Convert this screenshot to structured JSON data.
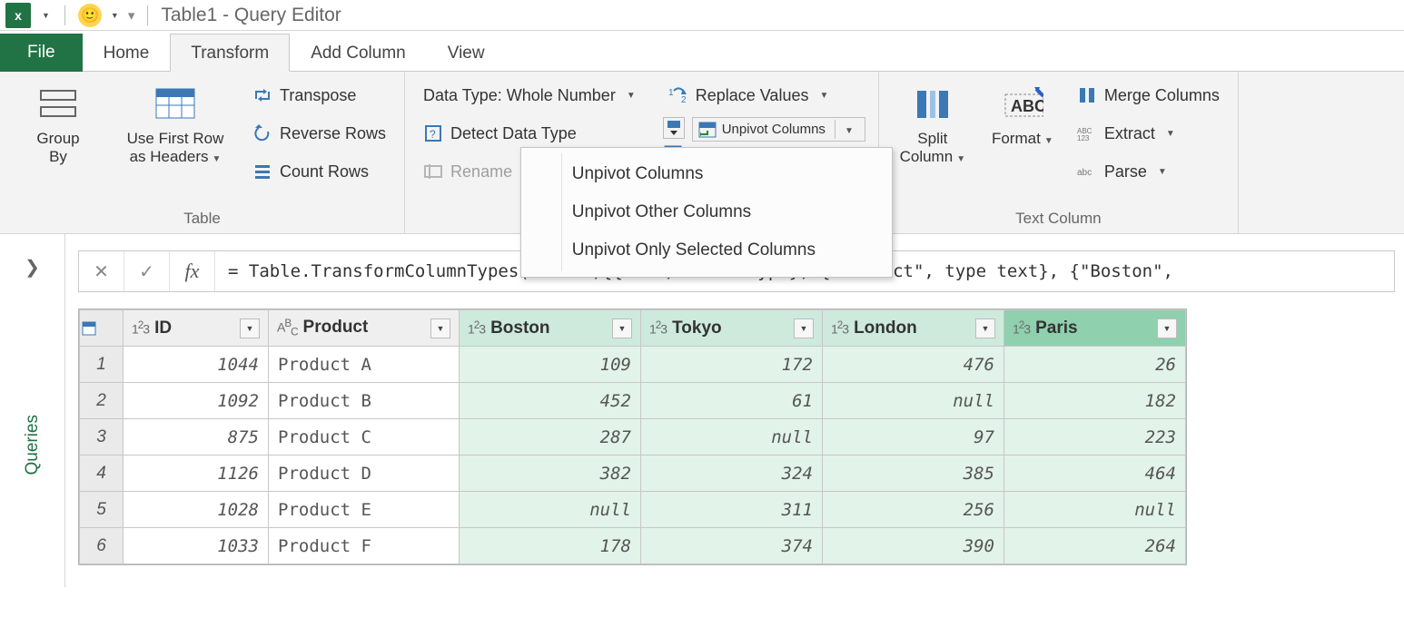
{
  "title": "Table1 - Query Editor",
  "tabs": {
    "file": "File",
    "home": "Home",
    "transform": "Transform",
    "addcol": "Add Column",
    "view": "View"
  },
  "ribbon": {
    "group_table_caption": "Table",
    "group_text_caption": "Text Column",
    "groupby": "Group\nBy",
    "firstrow": "Use First Row\nas Headers",
    "transpose": "Transpose",
    "reverse": "Reverse Rows",
    "count": "Count Rows",
    "datatype": "Data Type: Whole Number",
    "detect": "Detect Data Type",
    "rename": "Rename",
    "replace": "Replace Values",
    "unpivot": "Unpivot Columns",
    "menu": {
      "a": "Unpivot Columns",
      "b": "Unpivot Other Columns",
      "c": "Unpivot Only Selected Columns"
    },
    "split": "Split\nColumn",
    "format": "Format",
    "merge": "Merge Columns",
    "extract": "Extract",
    "parse": "Parse"
  },
  "queries_label": "Queries",
  "formula": "= Table.TransformColumnTypes(Source,{{\"ID\", Int64.Type}, {\"Product\", type text}, {\"Boston\",",
  "columns": [
    {
      "name": "ID",
      "type": "123",
      "sel": false
    },
    {
      "name": "Product",
      "type": "ABC",
      "sel": false
    },
    {
      "name": "Boston",
      "type": "123",
      "sel": true
    },
    {
      "name": "Tokyo",
      "type": "123",
      "sel": true
    },
    {
      "name": "London",
      "type": "123",
      "sel": true
    },
    {
      "name": "Paris",
      "type": "123",
      "sel": true,
      "hi": true
    }
  ],
  "rows": [
    {
      "n": "1",
      "id": "1044",
      "prod": "Product A",
      "c": [
        "109",
        "172",
        "476",
        "26"
      ]
    },
    {
      "n": "2",
      "id": "1092",
      "prod": "Product B",
      "c": [
        "452",
        "61",
        "null",
        "182"
      ]
    },
    {
      "n": "3",
      "id": "875",
      "prod": "Product C",
      "c": [
        "287",
        "null",
        "97",
        "223"
      ]
    },
    {
      "n": "4",
      "id": "1126",
      "prod": "Product D",
      "c": [
        "382",
        "324",
        "385",
        "464"
      ]
    },
    {
      "n": "5",
      "id": "1028",
      "prod": "Product E",
      "c": [
        "null",
        "311",
        "256",
        "null"
      ]
    },
    {
      "n": "6",
      "id": "1033",
      "prod": "Product F",
      "c": [
        "178",
        "374",
        "390",
        "264"
      ]
    }
  ]
}
